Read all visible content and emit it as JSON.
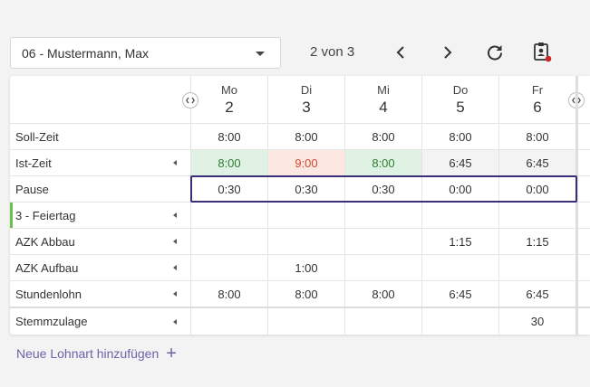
{
  "header": {
    "employee_select_value": "06 - Mustermann, Max",
    "pager_text": "2 von 3"
  },
  "icons": {
    "prev": "chevron-left-icon",
    "next": "chevron-right-icon",
    "refresh": "refresh-icon",
    "clipboard": "clipboard-user-icon"
  },
  "colors": {
    "accent": "#3a2d7a",
    "link": "#6a63a8",
    "green_bg": "#dff2e3",
    "green_text": "#2e7d32",
    "red_bg": "#fde7e3",
    "red_text": "#d04a2f",
    "notification_dot": "#c62828",
    "holiday_marker": "#6cc04a"
  },
  "days": [
    {
      "dow": "Mo",
      "num": "2"
    },
    {
      "dow": "Di",
      "num": "3"
    },
    {
      "dow": "Mi",
      "num": "4"
    },
    {
      "dow": "Do",
      "num": "5"
    },
    {
      "dow": "Fr",
      "num": "6"
    }
  ],
  "rows": [
    {
      "label": "Soll-Zeit",
      "values": [
        "8:00",
        "8:00",
        "8:00",
        "8:00",
        "8:00"
      ]
    },
    {
      "label": "Ist-Zeit",
      "values": [
        "8:00",
        "9:00",
        "8:00",
        "6:45",
        "6:45"
      ]
    },
    {
      "label": "Pause",
      "values": [
        "0:30",
        "0:30",
        "0:30",
        "0:00",
        "0:00"
      ]
    },
    {
      "label": "3 - Feiertag",
      "values": [
        "",
        "",
        "",
        "",
        ""
      ]
    },
    {
      "label": "AZK Abbau",
      "values": [
        "",
        "",
        "",
        "1:15",
        "1:15"
      ]
    },
    {
      "label": "AZK Aufbau",
      "values": [
        "",
        "1:00",
        "",
        "",
        ""
      ]
    },
    {
      "label": "Stundenlohn",
      "values": [
        "8:00",
        "8:00",
        "8:00",
        "6:45",
        "6:45"
      ]
    },
    {
      "label": "Stemmzulage",
      "values": [
        "",
        "",
        "",
        "",
        "30"
      ]
    }
  ],
  "add_link_label": "Neue Lohnart hinzufügen"
}
